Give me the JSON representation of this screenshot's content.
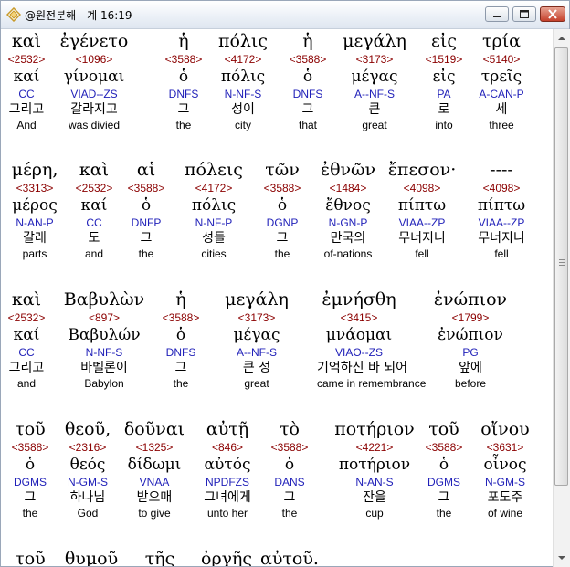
{
  "window": {
    "title": "@원전분해 - 계 16:19"
  },
  "rows": [
    {
      "words": [
        {
          "greek": "καὶ",
          "num": "<2532>",
          "lemma": "καί",
          "parse": "CC",
          "korean": "그리고",
          "english": "And"
        },
        {
          "greek": "ἐγένετο",
          "num": "<1096>",
          "lemma": "γίνομαι",
          "parse": "VIAD--ZS",
          "korean": "갈라지고",
          "english": "was divied"
        },
        {
          "greek": "ἡ",
          "num": "<3588>",
          "lemma": "ὁ",
          "parse": "DNFS",
          "korean": "그",
          "english": "the"
        },
        {
          "greek": "πόλις",
          "num": "<4172>",
          "lemma": "πόλις",
          "parse": "N-NF-S",
          "korean": "성이",
          "english": "city"
        },
        {
          "greek": "ἡ",
          "num": "<3588>",
          "lemma": "ὁ",
          "parse": "DNFS",
          "korean": "그",
          "english": "that"
        },
        {
          "greek": "μεγάλη",
          "num": "<3173>",
          "lemma": "μέγας",
          "parse": "A--NF-S",
          "korean": "큰",
          "english": "great"
        },
        {
          "greek": "εἰς",
          "num": "<1519>",
          "lemma": "εἰς",
          "parse": "PA",
          "korean": "로",
          "english": "into"
        },
        {
          "greek": "τρία",
          "num": "<5140>",
          "lemma": "τρεῖς",
          "parse": "A-CAN-P",
          "korean": "세",
          "english": "three"
        }
      ]
    },
    {
      "words": [
        {
          "greek": "μέρη,",
          "num": "<3313>",
          "lemma": "μέρος",
          "parse": "N-AN-P",
          "korean": "갈래",
          "english": "parts"
        },
        {
          "greek": "καὶ",
          "num": "<2532>",
          "lemma": "καί",
          "parse": "CC",
          "korean": "도",
          "english": "and"
        },
        {
          "greek": "αἱ",
          "num": "<3588>",
          "lemma": "ὁ",
          "parse": "DNFP",
          "korean": "그",
          "english": "the"
        },
        {
          "greek": "πόλεις",
          "num": "<4172>",
          "lemma": "πόλις",
          "parse": "N-NF-P",
          "korean": "성들",
          "english": "cities"
        },
        {
          "greek": "τῶν",
          "num": "<3588>",
          "lemma": "ὁ",
          "parse": "DGNP",
          "korean": "그",
          "english": "the"
        },
        {
          "greek": "ἐθνῶν",
          "num": "<1484>",
          "lemma": "ἔθνος",
          "parse": "N-GN-P",
          "korean": "만국의",
          "english": "of-nations"
        },
        {
          "greek": "ἔπεσον·",
          "num": "<4098>",
          "lemma": "πίπτω",
          "parse": "VIAA--ZP",
          "korean": "무너지니",
          "english": "fell"
        },
        {
          "greek": "----",
          "num": "<4098>",
          "lemma": "πίπτω",
          "parse": "VIAA--ZP",
          "korean": "무너지니",
          "english": "fell"
        }
      ]
    },
    {
      "words": [
        {
          "greek": "καὶ",
          "num": "<2532>",
          "lemma": "καί",
          "parse": "CC",
          "korean": "그리고",
          "english": "and"
        },
        {
          "greek": "Βαβυλὼν",
          "num": "<897>",
          "lemma": "Βαβυλών",
          "parse": "N-NF-S",
          "korean": "바벨론이",
          "english": "Babylon"
        },
        {
          "greek": "ἡ",
          "num": "<3588>",
          "lemma": "ὁ",
          "parse": "DNFS",
          "korean": "그",
          "english": "the"
        },
        {
          "greek": "μεγάλη",
          "num": "<3173>",
          "lemma": "μέγας",
          "parse": "A--NF-S",
          "korean": "큰 성",
          "english": "great"
        },
        {
          "greek": "ἐμνήσθη",
          "num": "<3415>",
          "lemma": "μνάομαι",
          "parse": "VIAO--ZS",
          "korean": "기억하신 바 되어",
          "english": "came in remembrance"
        },
        {
          "greek": "ἐνώπιον",
          "num": "<1799>",
          "lemma": "ἐνώπιον",
          "parse": "PG",
          "korean": "앞에",
          "english": "before"
        }
      ]
    },
    {
      "words": [
        {
          "greek": "τοῦ",
          "num": "<3588>",
          "lemma": "ὁ",
          "parse": "DGMS",
          "korean": "그",
          "english": "the"
        },
        {
          "greek": "θεοῦ,",
          "num": "<2316>",
          "lemma": "θεός",
          "parse": "N-GM-S",
          "korean": "하나님",
          "english": "God"
        },
        {
          "greek": "δοῦναι",
          "num": "<1325>",
          "lemma": "δίδωμι",
          "parse": "VNAA",
          "korean": "받으매",
          "english": "to give"
        },
        {
          "greek": "αὐτῇ",
          "num": "<846>",
          "lemma": "αὐτός",
          "parse": "NPDFZS",
          "korean": "그녀에게",
          "english": "unto her"
        },
        {
          "greek": "τὸ",
          "num": "<3588>",
          "lemma": "ὁ",
          "parse": "DANS",
          "korean": "그",
          "english": "the"
        },
        {
          "greek": "ποτήριον",
          "num": "<4221>",
          "lemma": "ποτήριον",
          "parse": "N-AN-S",
          "korean": "잔을",
          "english": "cup"
        },
        {
          "greek": "τοῦ",
          "num": "<3588>",
          "lemma": "ὁ",
          "parse": "DGMS",
          "korean": "그",
          "english": "the"
        },
        {
          "greek": "οἴνου",
          "num": "<3631>",
          "lemma": "οἶνος",
          "parse": "N-GM-S",
          "korean": "포도주",
          "english": "of wine"
        }
      ]
    },
    {
      "words": [
        {
          "greek": "τοῦ"
        },
        {
          "greek": "θυμοῦ"
        },
        {
          "greek": "τῆς"
        },
        {
          "greek": "ὀργῆς"
        },
        {
          "greek": "αὐτοῦ."
        }
      ]
    }
  ]
}
